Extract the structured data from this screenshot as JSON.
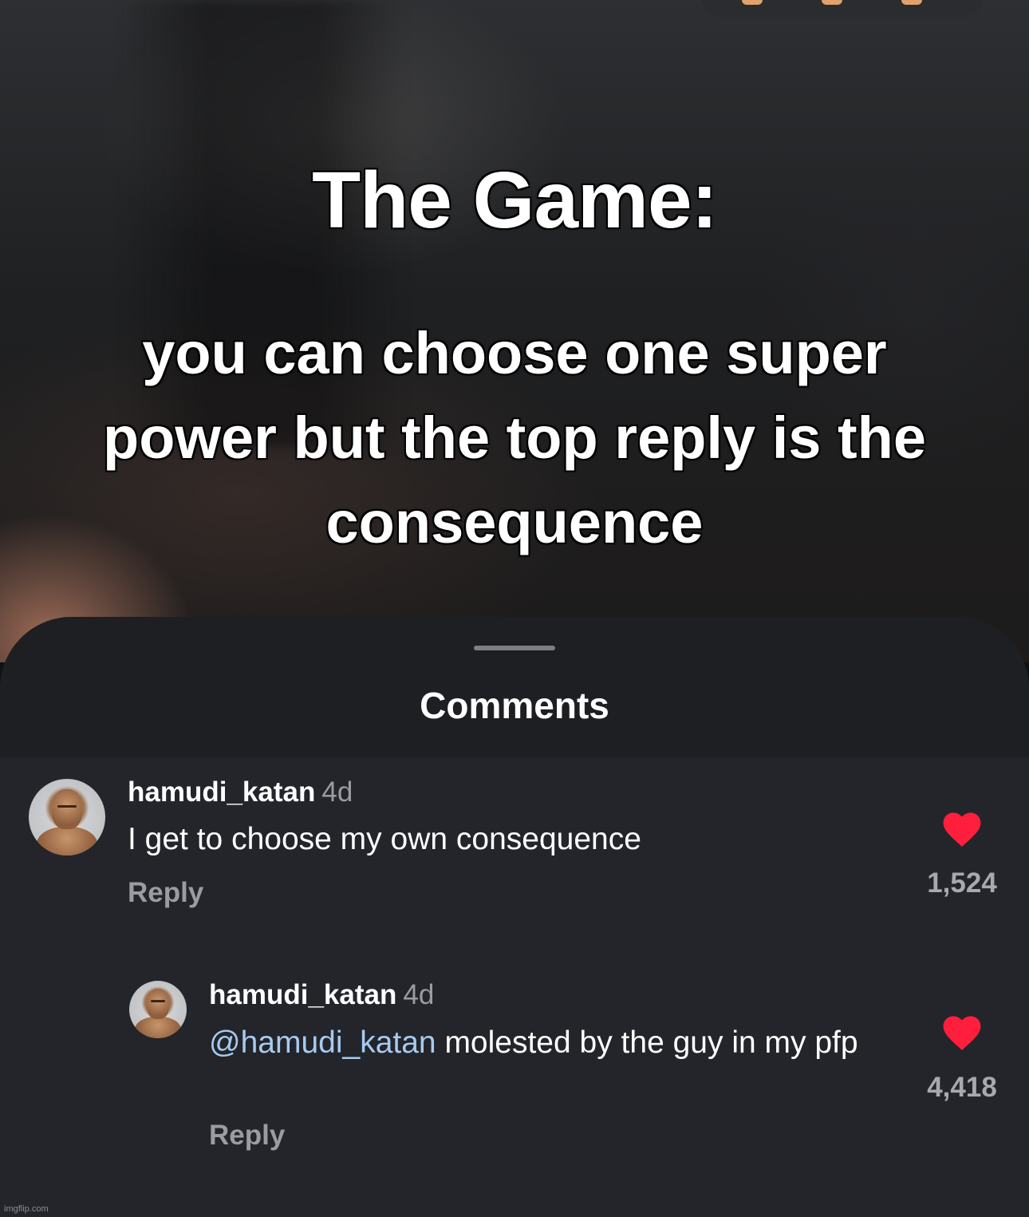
{
  "video": {
    "title": "The Game:",
    "caption": "you can choose one super power but the top reply is the consequence"
  },
  "comments_sheet": {
    "title": "Comments",
    "comments": [
      {
        "username": "hamudi_katan",
        "time": "4d",
        "text": "I get to choose my own consequence",
        "reply_label": "Reply",
        "likes": "1,524",
        "liked": true
      },
      {
        "username": "hamudi_katan",
        "time": "4d",
        "mention": "@hamudi_katan",
        "text": " molested by the guy in my pfp",
        "reply_label": "Reply",
        "likes": "4,418",
        "liked": true
      }
    ]
  },
  "watermark": "imgflip.com",
  "colors": {
    "sheet_background": "#23252a",
    "header_background": "#1e1f23",
    "like_heart": "#ff1f3d",
    "mention": "#a6cbf0",
    "muted_text": "#9a9ca1"
  },
  "icons": {
    "like": "heart-icon",
    "avatar": "avatar"
  }
}
